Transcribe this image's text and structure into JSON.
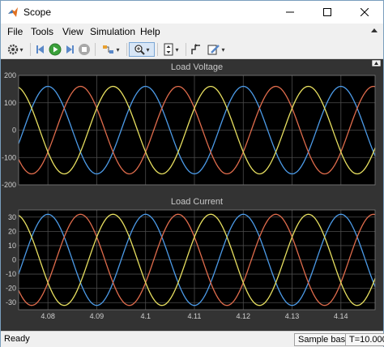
{
  "window": {
    "title": "Scope"
  },
  "menu": [
    {
      "label": "File"
    },
    {
      "label": "Tools"
    },
    {
      "label": "View"
    },
    {
      "label": "Simulation"
    },
    {
      "label": "Help"
    }
  ],
  "toolbar": {
    "icons": [
      "gear-icon",
      "step-back-icon",
      "run-icon",
      "step-forward-icon",
      "stop-icon",
      "highlight-icon",
      "zoom-icon",
      "fit-icon",
      "measure-icon",
      "edit-icon"
    ]
  },
  "status": {
    "text": "Ready",
    "sample": "Sample based",
    "time": "T=10.000"
  },
  "colors": {
    "bg": "#333333",
    "axes_bg": "#000000",
    "grid": "#4d4d4d",
    "series_1": "#4c9be8",
    "series_2": "#e06c4c",
    "series_3": "#e8e060"
  },
  "chart_data": [
    {
      "type": "line",
      "title": "Load Voltage",
      "xlim": [
        4.074,
        4.147
      ],
      "ylim": [
        -200,
        200
      ],
      "xticks": [
        "4.08",
        "4.09",
        "4.1",
        "4.11",
        "4.12",
        "4.13",
        "4.14"
      ],
      "xtick_values": [
        4.08,
        4.09,
        4.1,
        4.11,
        4.12,
        4.13,
        4.14
      ],
      "yticks": [
        "200",
        "100",
        "0",
        "-100",
        "-200"
      ],
      "ytick_values": [
        200,
        100,
        0,
        -100,
        -200
      ],
      "grid": true,
      "period": 0.02,
      "series": [
        {
          "amplitude": 160,
          "phase_deg": 90
        },
        {
          "amplitude": 160,
          "phase_deg": -30
        },
        {
          "amplitude": 160,
          "phase_deg": 210
        }
      ]
    },
    {
      "type": "line",
      "title": "Load Current",
      "xlim": [
        4.074,
        4.147
      ],
      "ylim": [
        -35,
        35
      ],
      "xticks": [
        "4.08",
        "4.09",
        "4.1",
        "4.11",
        "4.12",
        "4.13",
        "4.14"
      ],
      "xtick_values": [
        4.08,
        4.09,
        4.1,
        4.11,
        4.12,
        4.13,
        4.14
      ],
      "yticks": [
        "30",
        "20",
        "10",
        "0",
        "-10",
        "-20",
        "-30"
      ],
      "ytick_values": [
        30,
        20,
        10,
        0,
        -10,
        -20,
        -30
      ],
      "grid": true,
      "period": 0.02,
      "series": [
        {
          "amplitude": 32,
          "phase_deg": 90
        },
        {
          "amplitude": 32,
          "phase_deg": -30
        },
        {
          "amplitude": 32,
          "phase_deg": 210
        }
      ]
    }
  ]
}
